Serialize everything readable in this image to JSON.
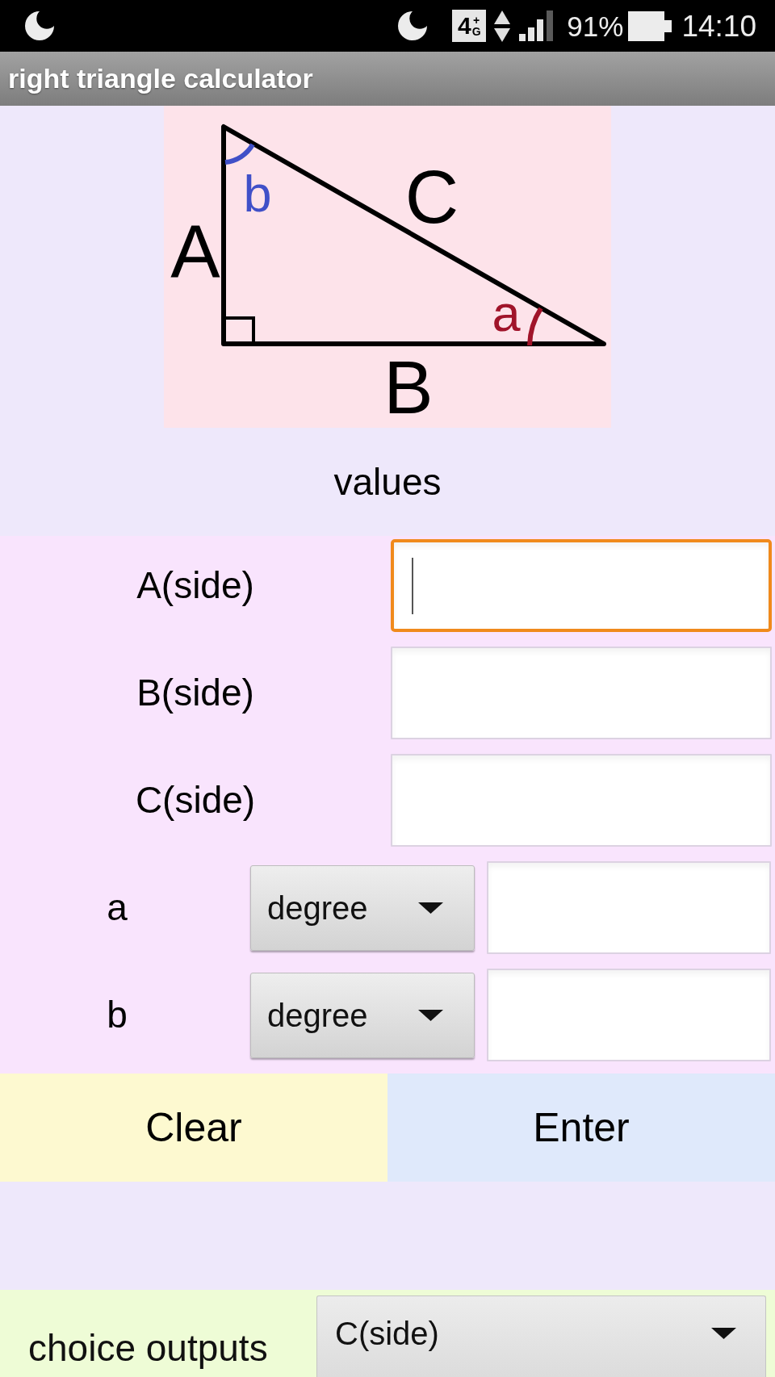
{
  "status_bar": {
    "network": {
      "digit": "4",
      "top": "+",
      "bottom": "G"
    },
    "battery": "91%",
    "time": "14:10"
  },
  "title_bar": {
    "title": "right triangle calculator"
  },
  "diagram": {
    "sides": [
      {
        "text": "A"
      },
      {
        "text": "B"
      },
      {
        "text": "C"
      }
    ],
    "angles": [
      {
        "text": "a",
        "color": "#a0142a"
      },
      {
        "text": "b",
        "color": "#4050c8"
      }
    ]
  },
  "values_heading": "values",
  "side_inputs": [
    {
      "label": "A(side)",
      "focused": true
    },
    {
      "label": "B(side)",
      "focused": false
    },
    {
      "label": "C(side)",
      "focused": false
    }
  ],
  "angle_inputs": [
    {
      "label": "a",
      "unit": "degree",
      "focused": false
    },
    {
      "label": "b",
      "unit": "degree",
      "focused": false
    }
  ],
  "buttons": [
    {
      "label": "Clear"
    },
    {
      "label": "Enter"
    }
  ],
  "output": {
    "label": "choice outputs",
    "value": "C(side)"
  }
}
